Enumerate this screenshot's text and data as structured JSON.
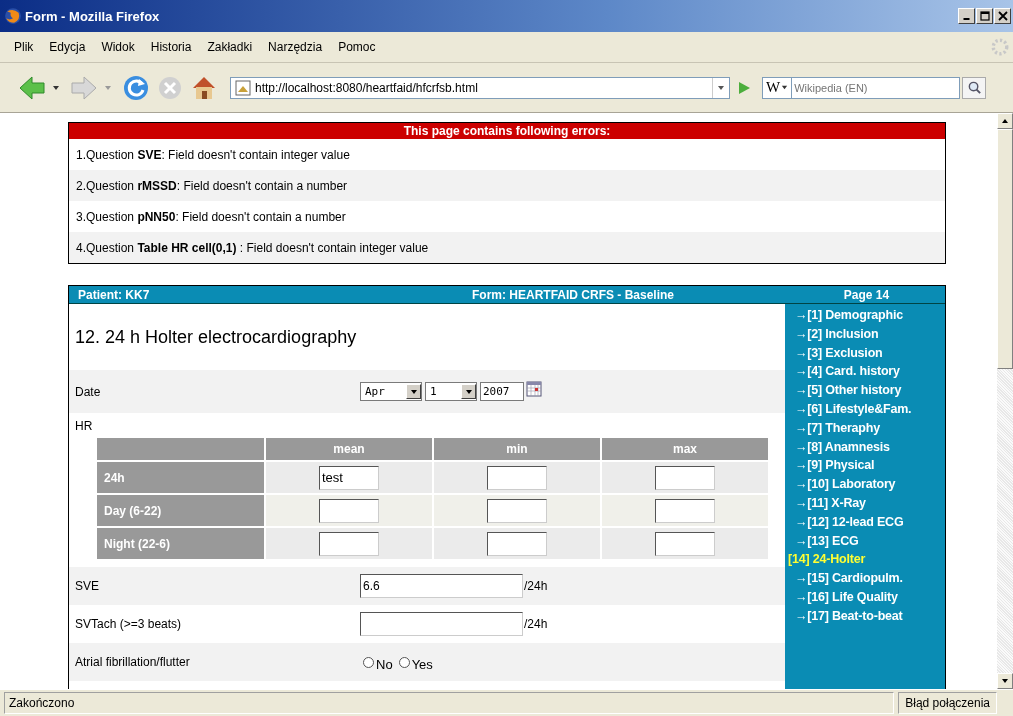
{
  "window": {
    "title": "Form - Mozilla Firefox"
  },
  "menu": [
    "Plik",
    "Edycja",
    "Widok",
    "Historia",
    "Zakładki",
    "Narzędzia",
    "Pomoc"
  ],
  "toolbar": {
    "url": "http://localhost:8080/heartfaid/hfcrfsb.html",
    "search_placeholder": "Wikipedia (EN)",
    "search_engine": "W"
  },
  "errors": {
    "title": "This page contains following errors:",
    "items": [
      "1.Question **SVE**: Field doesn't contain integer value",
      "2.Question **rMSSD**: Field doesn't contain a number",
      "3.Question **pNN50**: Field doesn't contain a number",
      "4.Question **Table HR cell(0,1)** : Field doesn't contain integer value"
    ]
  },
  "form_header": {
    "patient": "Patient: KK7",
    "form": "Form: HEARTFAID CRFS - Baseline",
    "page": "Page 14"
  },
  "section_title": "12. 24 h Holter electrocardiography",
  "date": {
    "label": "Date",
    "month": "Apr",
    "day": "1",
    "year": "2007"
  },
  "hr": {
    "label": "HR",
    "columns": [
      "mean",
      "min",
      "max"
    ],
    "rows": [
      {
        "label": "24h",
        "cells": [
          {
            "value": "test"
          },
          {},
          {}
        ]
      },
      {
        "label": "Day (6-22)",
        "cells": [
          {},
          {},
          {}
        ]
      },
      {
        "label": "Night (22-6)",
        "cells": [
          {},
          {},
          {}
        ]
      }
    ]
  },
  "fields": [
    {
      "label": "SVE",
      "value": "6.6",
      "unit": "/24h"
    },
    {
      "label": "SVTach (>=3 beats)",
      "unit": "/24h"
    }
  ],
  "af": {
    "label": "Atrial fibrillation/flutter",
    "options": [
      {
        "label": "No",
        "selected": false
      },
      {
        "label": "Yes",
        "selected": false
      }
    ]
  },
  "nav": [
    {
      "arrow": "→",
      "label": "[1] Demographic",
      "selected": false
    },
    {
      "arrow": "→",
      "label": "[2] Inclusion",
      "selected": false
    },
    {
      "arrow": "→",
      "label": "[3] Exclusion",
      "selected": false
    },
    {
      "arrow": "→",
      "label": "[4] Card. history",
      "selected": false
    },
    {
      "arrow": "→",
      "label": "[5] Other history",
      "selected": false
    },
    {
      "arrow": "→",
      "label": "[6] Lifestyle&Fam.",
      "selected": false
    },
    {
      "arrow": "→",
      "label": "[7] Theraphy",
      "selected": false
    },
    {
      "arrow": "→",
      "label": "[8] Anamnesis",
      "selected": false
    },
    {
      "arrow": "→",
      "label": "[9] Physical",
      "selected": false
    },
    {
      "arrow": "→",
      "label": "[10] Laboratory",
      "selected": false
    },
    {
      "arrow": "→",
      "label": "[11] X-Ray",
      "selected": false
    },
    {
      "arrow": "→",
      "label": "[12] 12-lead ECG",
      "selected": false
    },
    {
      "arrow": "→",
      "label": "[13] ECG",
      "selected": false
    },
    {
      "label": "[14] 24-Holter",
      "selected": true
    },
    {
      "arrow": "→",
      "label": "[15] Cardiopulm.",
      "selected": false
    },
    {
      "arrow": "→",
      "label": "[16] Life Quality",
      "selected": false
    },
    {
      "arrow": "→",
      "label": "[17] Beat-to-beat",
      "selected": false
    }
  ],
  "status_bar": {
    "left": "Zakończono",
    "right": "Błąd połączenia"
  }
}
